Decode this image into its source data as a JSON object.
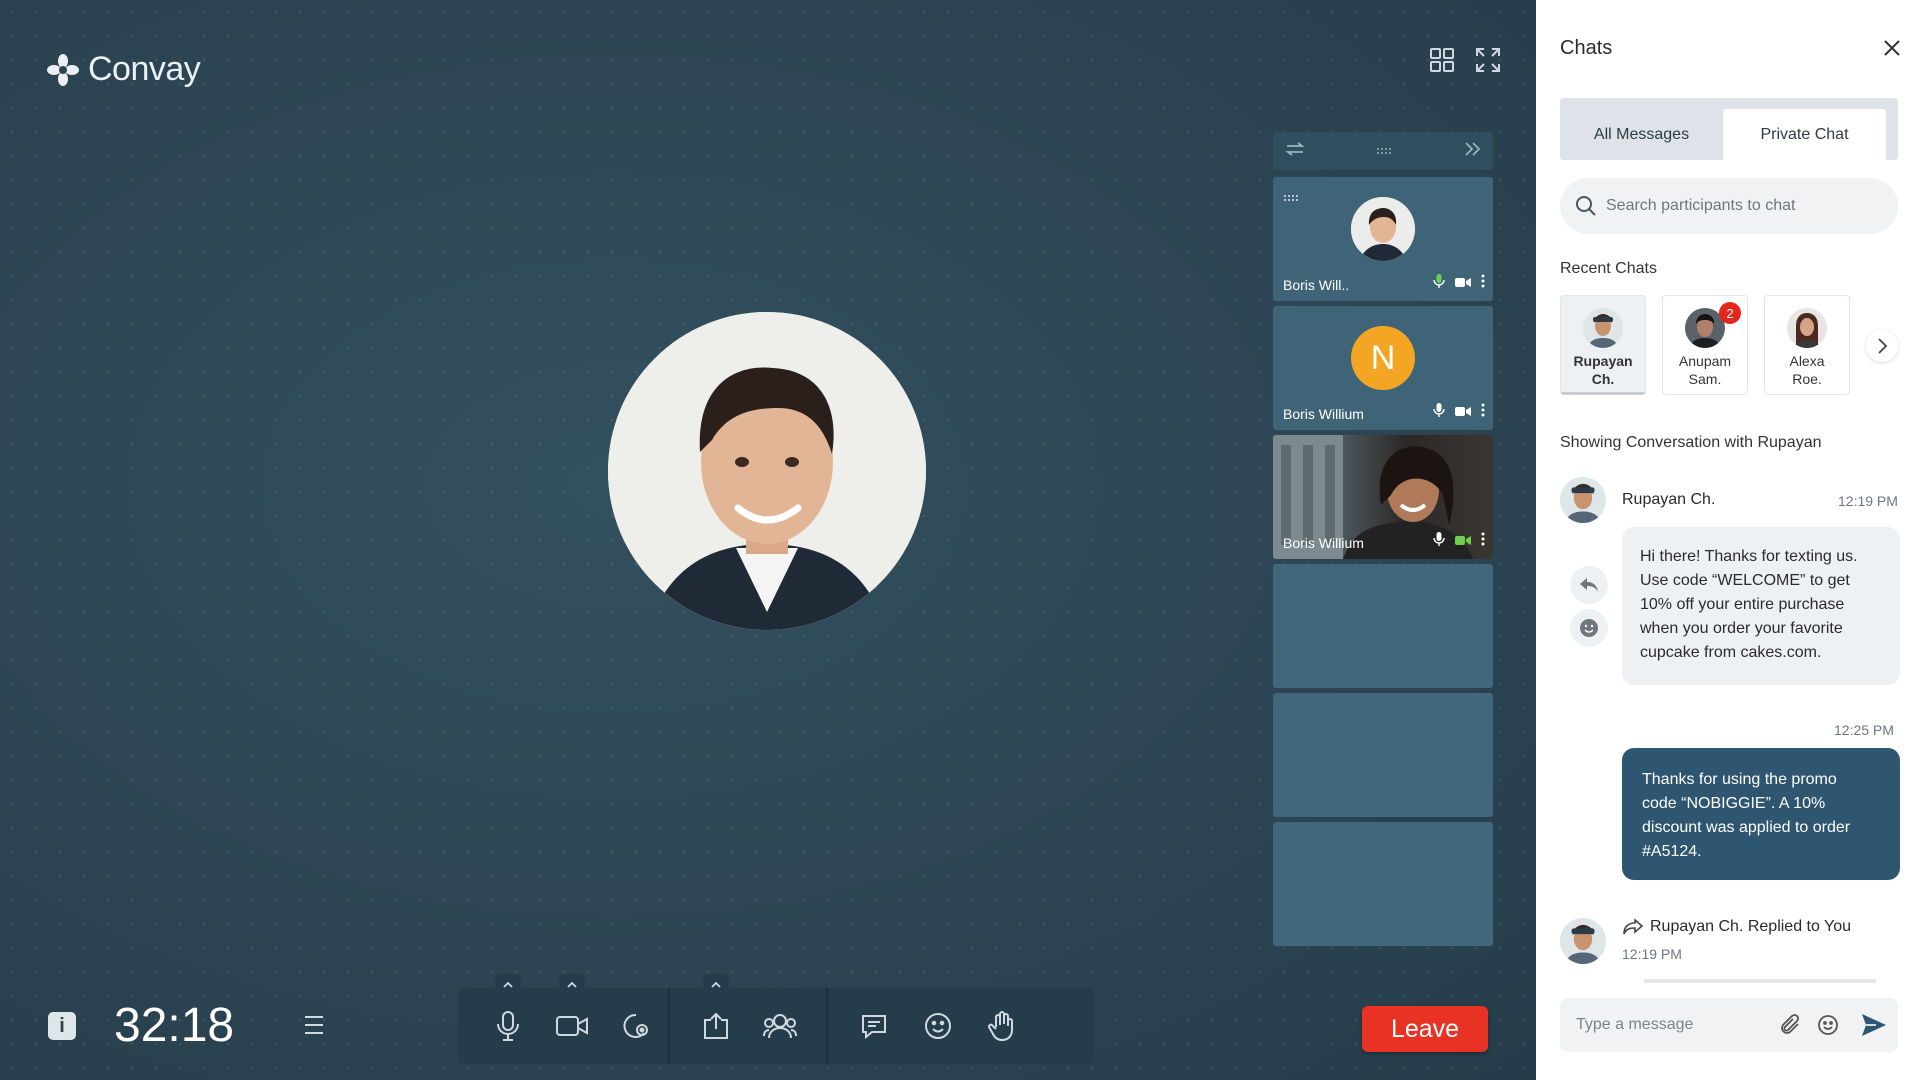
{
  "app": {
    "brand": "Convay",
    "timer": "32:18",
    "leave_label": "Leave"
  },
  "participants": [
    {
      "name": "Boris Will..",
      "kind": "photo",
      "mic": "active",
      "camera": "on"
    },
    {
      "name": "Boris Willium",
      "kind": "initial",
      "initial": "N",
      "initial_color": "#f3a523",
      "mic": "on",
      "camera": "on"
    },
    {
      "name": "Boris Willium",
      "kind": "video",
      "mic": "on",
      "camera": "active"
    }
  ],
  "toolbar": {
    "items": [
      "microphone",
      "camera",
      "effects",
      "share-screen",
      "participants",
      "chat",
      "reactions",
      "raise-hand"
    ]
  },
  "chat": {
    "title": "Chats",
    "tabs": [
      {
        "label": "All Messages",
        "active": false
      },
      {
        "label": "Private Chat",
        "active": true
      }
    ],
    "search_placeholder": "Search participants to chat",
    "recent_label": "Recent Chats",
    "recent": [
      {
        "name_line1": "Rupayan",
        "name_line2": "Ch.",
        "active": true,
        "badge": ""
      },
      {
        "name_line1": "Anupam",
        "name_line2": "Sam.",
        "active": false,
        "badge": "2"
      },
      {
        "name_line1": "Alexa",
        "name_line2": "Roe.",
        "active": false,
        "badge": ""
      }
    ],
    "conversation_label": "Showing Conversation with Rupayan",
    "messages": [
      {
        "sender": "Rupayan Ch.",
        "time": "12:19 PM",
        "direction": "incoming",
        "lines": [
          "Hi there! Thanks for texting us.",
          "Use code “WELCOME” to get",
          "10% off your entire purchase",
          "when you order your favorite",
          "cupcake from cakes.com."
        ]
      },
      {
        "time": "12:25 PM",
        "direction": "outgoing",
        "lines": [
          "Thanks for using the promo",
          "code “NOBIGGIE”. A 10%",
          "discount was applied to order",
          "#A5124."
        ]
      },
      {
        "reply_label": "Rupayan Ch. Replied to You",
        "time": "12:19 PM"
      }
    ],
    "composer_placeholder": "Type a message"
  },
  "colors": {
    "stage": "#2c4352",
    "accent_bubble": "#2e5670",
    "leave": "#e83224",
    "badge": "#e5261d"
  }
}
